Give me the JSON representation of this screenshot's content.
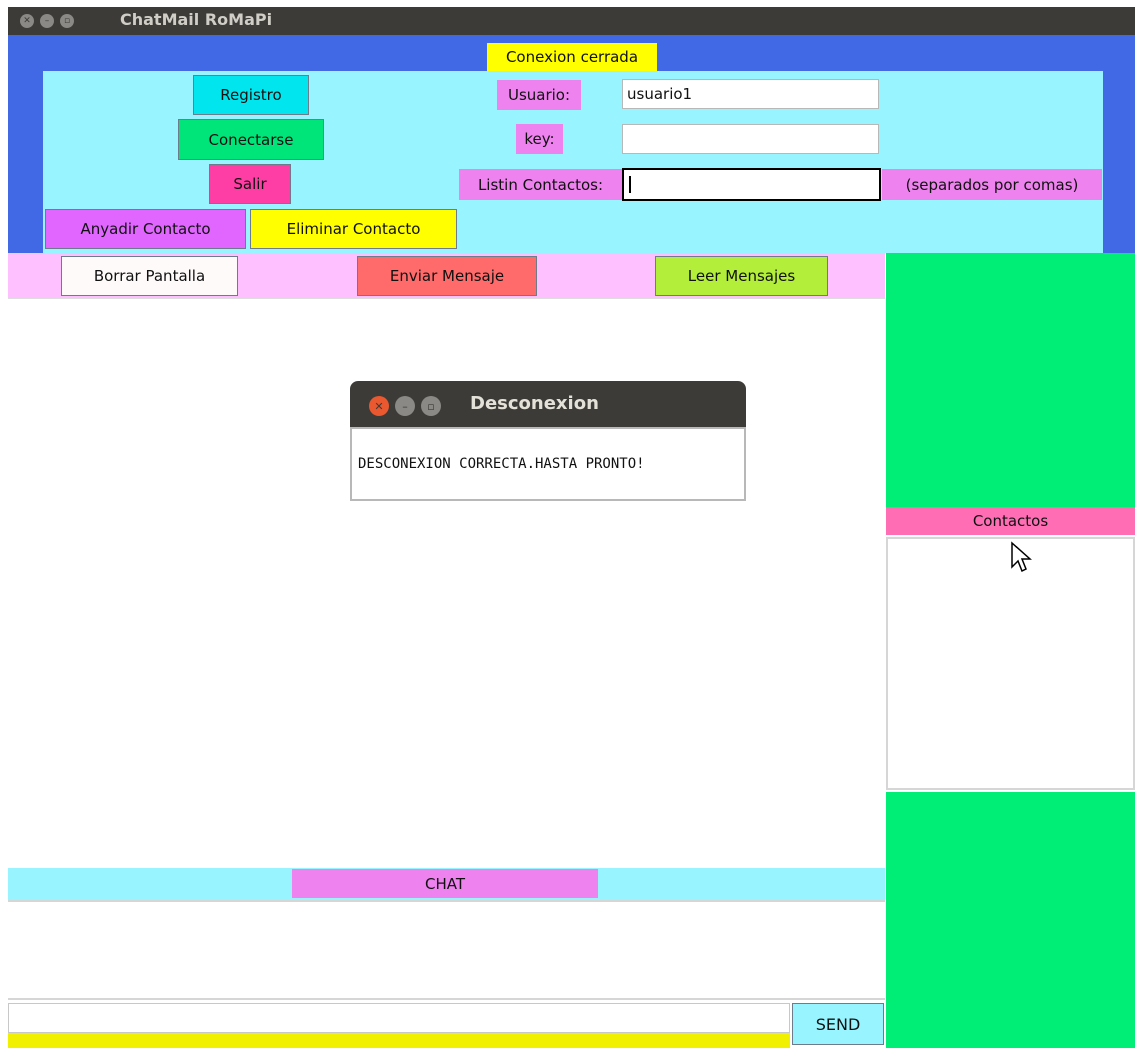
{
  "window": {
    "title": "ChatMail RoMaPi"
  },
  "status": {
    "text": "Conexion cerrada"
  },
  "auth": {
    "usuario_label": "Usuario:",
    "usuario_value": "usuario1",
    "key_label": "key:",
    "key_value": "",
    "listin_label": "Listin Contactos:",
    "listin_value": "",
    "listin_hint": "(separados por comas)"
  },
  "buttons": {
    "registro": "Registro",
    "conectarse": "Conectarse",
    "salir": "Salir",
    "anyadir": "Anyadir Contacto",
    "eliminar": "Eliminar Contacto",
    "borrar": "Borrar Pantalla",
    "enviar": "Enviar Mensaje",
    "leer": "Leer Mensajes",
    "send": "SEND"
  },
  "contacts": {
    "header": "Contactos"
  },
  "chat": {
    "label": "CHAT",
    "input_value": ""
  },
  "dialog": {
    "title": "Desconexion",
    "message": "DESCONEXION CORRECTA.HASTA PRONTO!"
  },
  "colors": {
    "frame_blue": "#4169e6",
    "cyan_panel": "#98f5ff",
    "green_side": "#00ee76",
    "pink_header": "#ff6eb4",
    "violet_label": "#ee82ee",
    "yellow": "#ffff00"
  }
}
